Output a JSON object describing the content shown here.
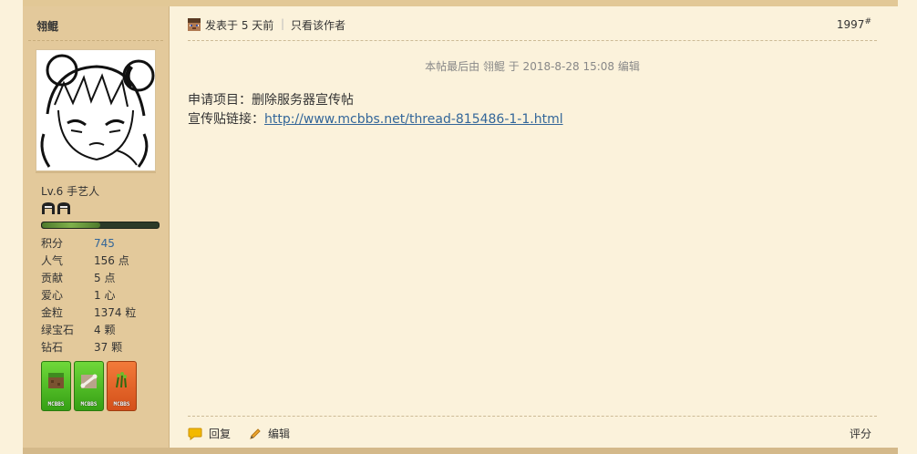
{
  "author": {
    "name": "翎鲲",
    "level": "Lv.6 手艺人"
  },
  "stats": [
    {
      "label": "积分",
      "value": "745",
      "link": true
    },
    {
      "label": "人气",
      "value": "156 点",
      "link": false
    },
    {
      "label": "贡献",
      "value": "5 点",
      "link": false
    },
    {
      "label": "爱心",
      "value": "1 心",
      "link": false
    },
    {
      "label": "金粒",
      "value": "1374 粒",
      "link": false
    },
    {
      "label": "绿宝石",
      "value": "4 颗",
      "link": false
    },
    {
      "label": "钻石",
      "value": "37 颗",
      "link": false
    }
  ],
  "level_progress": 0.5,
  "badges": [
    {
      "text": "MCBBS",
      "color": "green",
      "icon": "dirt-block-icon"
    },
    {
      "text": "MCBBS",
      "color": "green",
      "icon": "bone-icon"
    },
    {
      "text": "MCBBS",
      "color": "orange",
      "icon": "wheat-seed-icon"
    }
  ],
  "post": {
    "time": "发表于 5 天前",
    "separator": "|",
    "author_only": "只看该作者",
    "floor": "1997",
    "floor_mark": "#",
    "edit_note": "本帖最后由 翎鲲 于 2018-8-28 15:08 编辑",
    "line1": "申请项目：删除服务器宣传帖",
    "line2_label": "宣传贴链接：",
    "line2_link": "http://www.mcbbs.net/thread-815486-1-1.html"
  },
  "footer": {
    "reply": "回复",
    "edit": "编辑",
    "rate": "评分"
  },
  "colors": {
    "page_bg": "#fbf2db",
    "sidebar_bg": "#e3c99b",
    "link": "#336699"
  }
}
